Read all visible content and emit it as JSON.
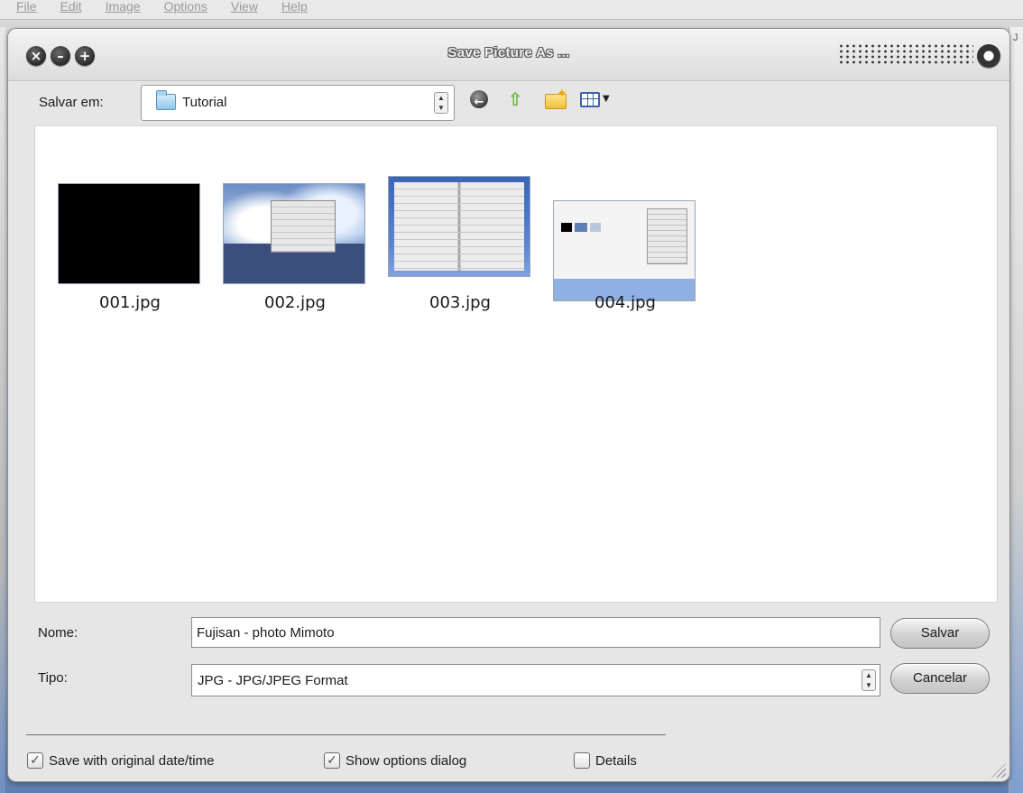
{
  "app_menu": [
    "File",
    "Edit",
    "Image",
    "Options",
    "View",
    "Help"
  ],
  "bg_right_letter": "J",
  "dialog": {
    "title": "Save Picture As ...",
    "title_buttons": {
      "close": "×",
      "minimize": "–",
      "zoom": "+"
    }
  },
  "toolbar": {
    "save_in_label": "Salvar em:",
    "folder": "Tutorial",
    "icons": [
      "back-icon",
      "up-folder-icon",
      "new-folder-icon",
      "view-menu-icon"
    ]
  },
  "files": [
    {
      "name": "001.jpg"
    },
    {
      "name": "002.jpg"
    },
    {
      "name": "003.jpg"
    },
    {
      "name": "004.jpg"
    }
  ],
  "form": {
    "name_label": "Nome:",
    "name_value": "Fujisan - photo Mimoto",
    "type_label": "Tipo:",
    "type_value": "JPG - JPG/JPEG Format",
    "save_button": "Salvar",
    "cancel_button": "Cancelar"
  },
  "options": [
    {
      "label": "Save with original date/time",
      "checked": true
    },
    {
      "label": "Show options dialog",
      "checked": true
    },
    {
      "label": "Details",
      "checked": false
    }
  ]
}
